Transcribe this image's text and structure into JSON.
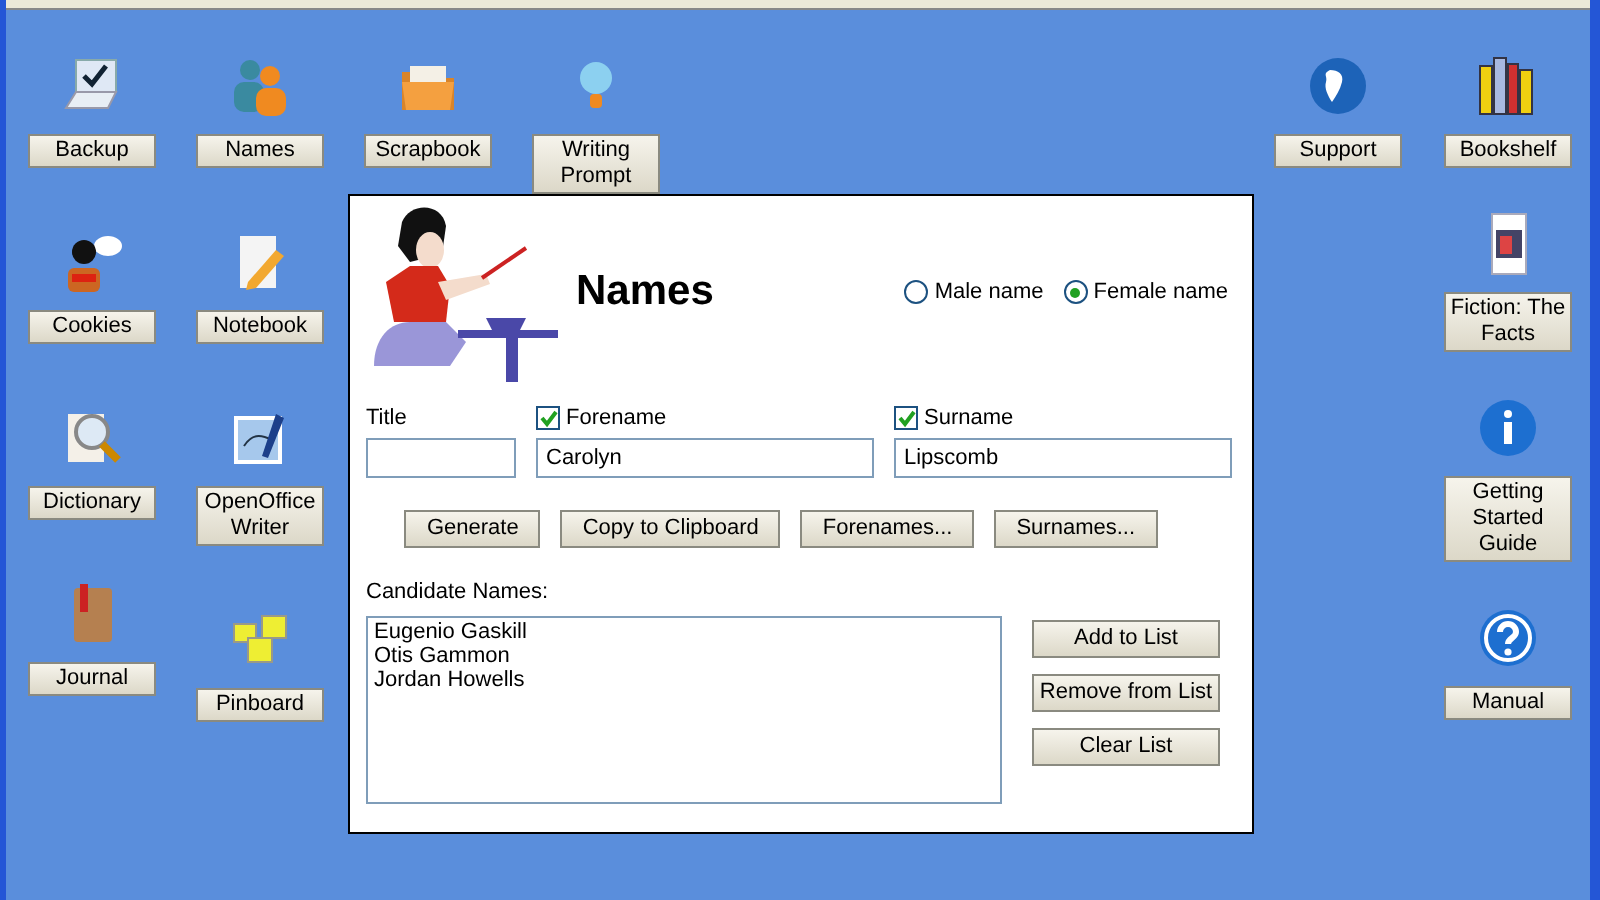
{
  "desktop_columns": [
    {
      "items": [
        {
          "label": "Backup",
          "kind": "laptop"
        },
        {
          "label": "Cookies",
          "kind": "speaker"
        },
        {
          "label": "Dictionary",
          "kind": "magnifier"
        },
        {
          "label": "Journal",
          "kind": "book"
        }
      ]
    },
    {
      "items": [
        {
          "label": "Names",
          "kind": "people"
        },
        {
          "label": "Notebook",
          "kind": "notepad"
        },
        {
          "label": "OpenOffice Writer",
          "kind": "writer"
        },
        {
          "label": "Pinboard",
          "kind": "notes"
        }
      ]
    },
    {
      "items": [
        {
          "label": "Scrapbook",
          "kind": "folder"
        }
      ]
    },
    {
      "items": [
        {
          "label": "Writing Prompt",
          "kind": "bulb"
        }
      ]
    }
  ],
  "right_columns": [
    {
      "items": [
        {
          "label": "Support",
          "kind": "globe"
        }
      ]
    },
    {
      "items": [
        {
          "label": "Bookshelf",
          "kind": "books"
        },
        {
          "label": "Fiction: The Facts",
          "kind": "cover"
        },
        {
          "label": "Getting Started Guide",
          "kind": "info"
        },
        {
          "label": "Manual",
          "kind": "help"
        }
      ]
    }
  ],
  "dialog": {
    "title": "Names",
    "gender": [
      {
        "label": "Male name",
        "selected": false
      },
      {
        "label": "Female name",
        "selected": true
      }
    ],
    "fields": [
      {
        "label": "Title",
        "kind": "plain"
      },
      {
        "label": "Forename",
        "value": "Carolyn",
        "kind": "checkbox",
        "checked": true
      },
      {
        "label": "Surname",
        "value": "Lipscomb",
        "kind": "checkbox",
        "checked": true
      }
    ],
    "actions": [
      "Generate",
      "Copy to Clipboard",
      "Forenames...",
      "Surnames..."
    ],
    "list_label": "Candidate Names:",
    "candidates": [
      "Eugenio Gaskill",
      "Otis Gammon",
      "Jordan Howells"
    ],
    "list_actions": [
      "Add to List",
      "Remove from List",
      "Clear List"
    ]
  }
}
